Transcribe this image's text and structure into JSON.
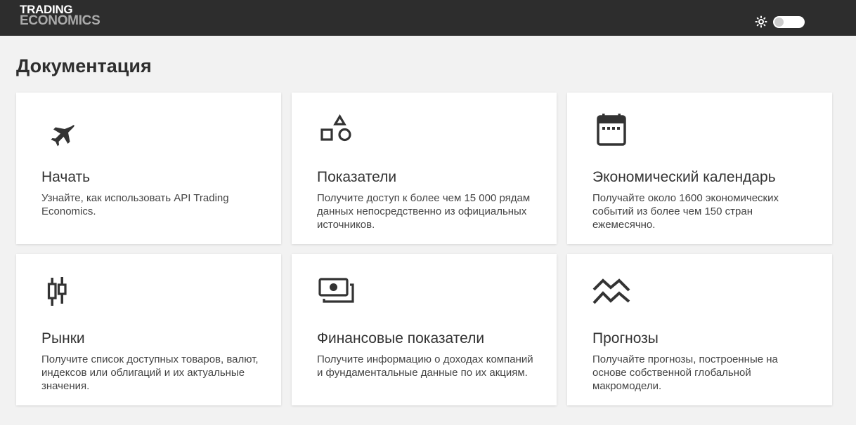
{
  "header": {
    "logo_line1": "TRADING",
    "logo_line2": "ECONOMICS",
    "theme_icon": "sun-icon",
    "background": "#2d2d2d"
  },
  "page": {
    "title": "Документация"
  },
  "cards": [
    {
      "icon": "airplane-icon",
      "title": "Начать",
      "description": "Узнайте, как использовать API Trading Economics."
    },
    {
      "icon": "shapes-icon",
      "title": "Показатели",
      "description": "Получите доступ к более чем 15 000 рядам данных непосредственно из официальных источников."
    },
    {
      "icon": "calendar-icon",
      "title": "Экономический календарь",
      "description": "Получайте около 1600 экономических событий из более чем 150 стран ежемесячно."
    },
    {
      "icon": "candlestick-icon",
      "title": "Рынки",
      "description": "Получите список доступных товаров, валют, индексов или облигаций и их актуальные значения."
    },
    {
      "icon": "money-icon",
      "title": "Финансовые показатели",
      "description": "Получите информацию о доходах компаний и фундаментальные данные по их акциям."
    },
    {
      "icon": "forecast-icon",
      "title": "Прогнозы",
      "description": "Получайте прогнозы, построенные на основе собственной глобальной макромодели."
    }
  ]
}
